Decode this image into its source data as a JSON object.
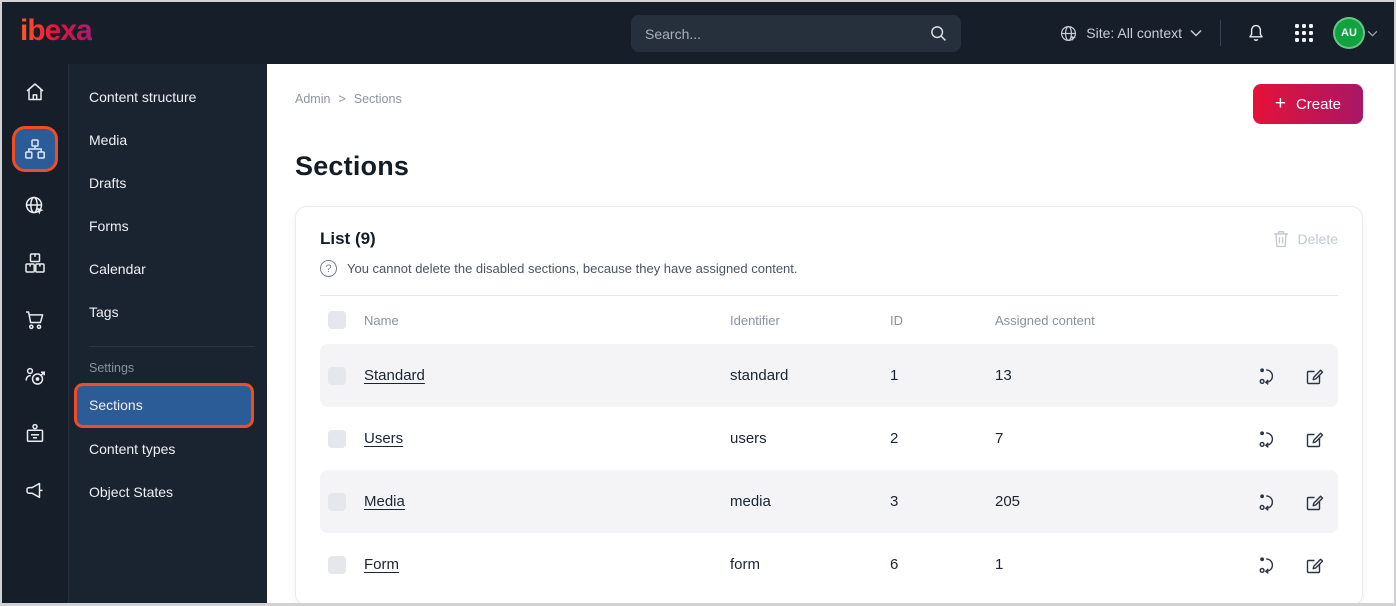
{
  "topbar": {
    "logo_text": "ibexa",
    "search_placeholder": "Search...",
    "site_context_label": "Site: All context",
    "avatar_initials": "AU",
    "icons": [
      "globe-icon",
      "chevron-down-icon",
      "bell-icon",
      "app-grid-icon"
    ]
  },
  "icon_rail": {
    "icons": [
      "home-icon",
      "content-structure-tree-icon",
      "globe-pointer-icon",
      "boxes-icon",
      "cart-icon",
      "person-target-icon",
      "badge-icon",
      "megaphone-icon"
    ],
    "active_icon": "content-structure-tree-icon"
  },
  "sidebar": {
    "items": [
      "Content structure",
      "Media",
      "Drafts",
      "Forms",
      "Calendar",
      "Tags"
    ],
    "settings_header": "Settings",
    "settings_items": [
      "Sections",
      "Content types",
      "Object States"
    ],
    "active_item": "Sections"
  },
  "main": {
    "breadcrumb": [
      "Admin",
      "Sections"
    ],
    "breadcrumb_separator": ">",
    "create_label": "Create",
    "plus_glyph": "+",
    "title": "Sections",
    "list": {
      "header": "List (9)",
      "question_glyph": "?",
      "info": "You cannot delete the disabled sections, because they have assigned content.",
      "delete_label": "Delete",
      "columns": [
        "Name",
        "Identifier",
        "ID",
        "Assigned content"
      ],
      "rows": [
        {
          "name": "Standard",
          "identifier": "standard",
          "id": "1",
          "assigned": "13"
        },
        {
          "name": "Users",
          "identifier": "users",
          "id": "2",
          "assigned": "7"
        },
        {
          "name": "Media",
          "identifier": "media",
          "id": "3",
          "assigned": "205"
        },
        {
          "name": "Form",
          "identifier": "form",
          "id": "6",
          "assigned": "1"
        }
      ],
      "row_action_icons": [
        "assign-content-icon",
        "edit-icon"
      ]
    }
  },
  "colors": {
    "topbar_bg": "#161e29",
    "active_blue": "#2b5c98",
    "annotation_orange": "#f14d24",
    "create_gradient_start": "#e41239",
    "create_gradient_end": "#aa1766",
    "avatar_green": "#11a13e",
    "shaded_row": "#f4f4f6",
    "text_dark": "#131c26"
  }
}
